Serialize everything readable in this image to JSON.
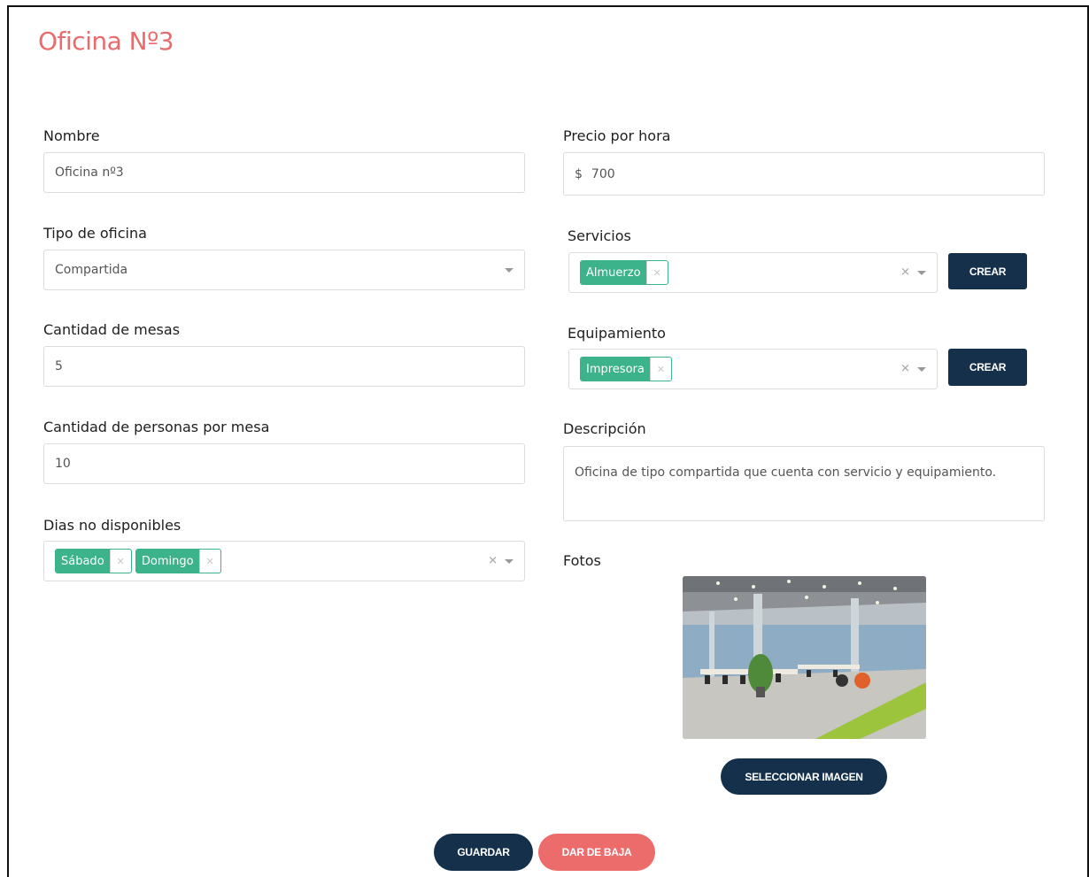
{
  "page": {
    "title": "Oficina Nº3"
  },
  "form": {
    "nombre": {
      "label": "Nombre",
      "value": "Oficina nº3"
    },
    "precio": {
      "label": "Precio por hora",
      "currency": "$",
      "value": "700"
    },
    "tipo": {
      "label": "Tipo de oficina",
      "value": "Compartida"
    },
    "servicios": {
      "label": "Servicios",
      "tags": [
        "Almuerzo"
      ],
      "create_label": "CREAR"
    },
    "mesas": {
      "label": "Cantidad de mesas",
      "value": "5"
    },
    "equipamiento": {
      "label": "Equipamiento",
      "tags": [
        "Impresora"
      ],
      "create_label": "CREAR"
    },
    "personas": {
      "label": "Cantidad de personas por mesa",
      "value": "10"
    },
    "descripcion": {
      "label": "Descripción",
      "value": "Oficina de tipo compartida que cuenta con servicio y equipamiento."
    },
    "dias": {
      "label": "Dias no disponibles",
      "tags": [
        "Sábado",
        "Domingo"
      ]
    },
    "fotos": {
      "label": "Fotos",
      "select_label": "SELECCIONAR IMAGEN"
    }
  },
  "actions": {
    "save_label": "GUARDAR",
    "delete_label": "DAR DE BAJA"
  },
  "colors": {
    "accent": "#e96b6b",
    "primary": "#14304a",
    "tag": "#3cb38a",
    "danger": "#ec6b6b"
  }
}
